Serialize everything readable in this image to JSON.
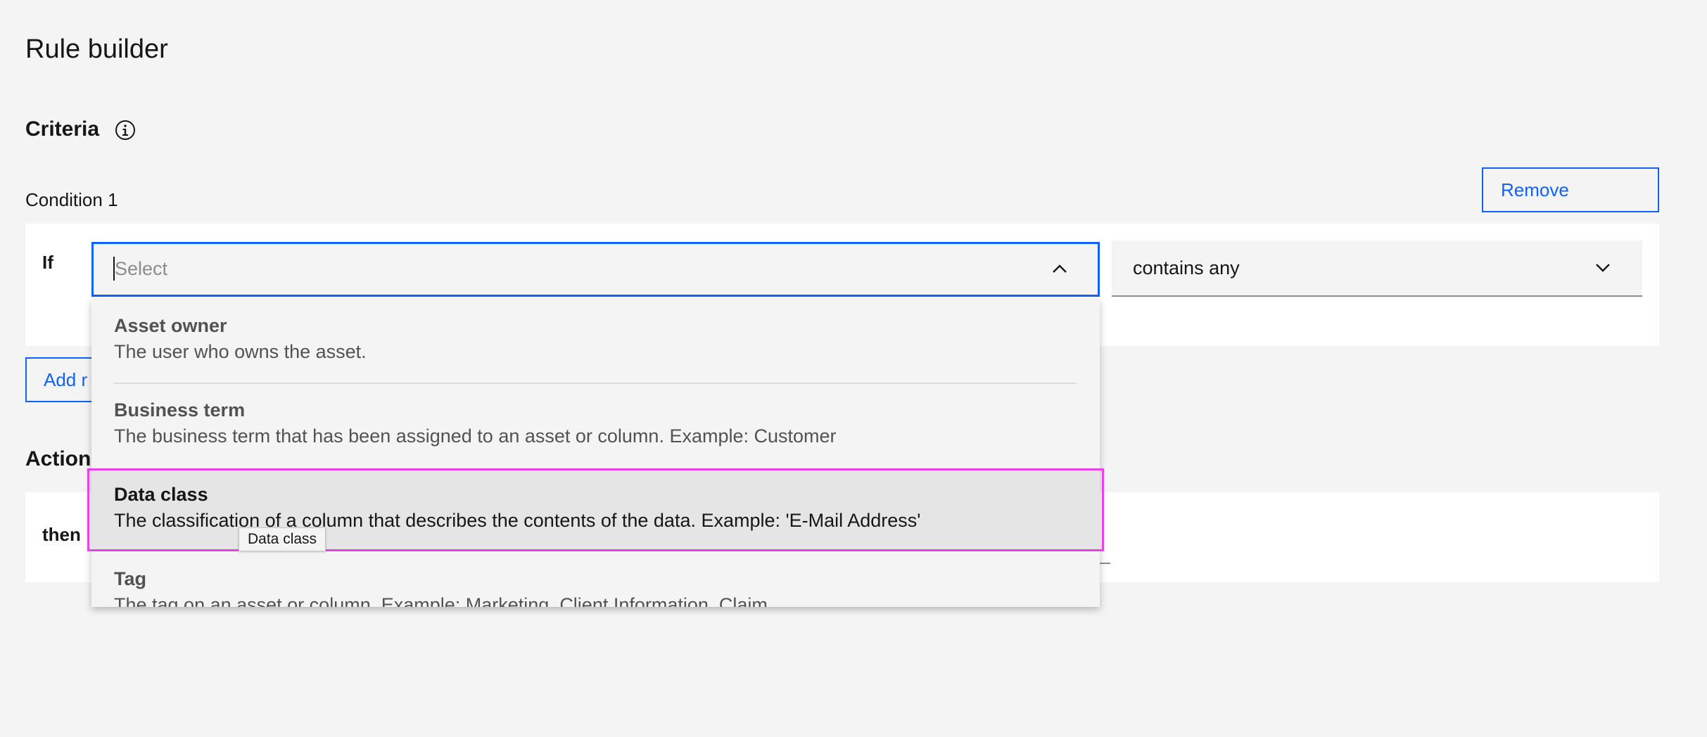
{
  "header": {
    "title": "Rule builder"
  },
  "criteria": {
    "heading": "Criteria"
  },
  "condition": {
    "label": "Condition 1",
    "remove_label": "Remove",
    "if_label": "If",
    "select_placeholder": "Select",
    "operator_value": "contains any"
  },
  "add_button_label": "Add r",
  "actions": {
    "heading": "Action",
    "then_label": "then"
  },
  "dropdown": {
    "options": [
      {
        "title": "Asset owner",
        "description": "The user who owns the asset."
      },
      {
        "title": "Business term",
        "description": "The business term that has been assigned to an asset or column. Example: Customer"
      },
      {
        "title": "Data class",
        "description": "The classification of a column that describes the contents of the data. Example: 'E-Mail Address'"
      },
      {
        "title": "Tag",
        "description": "The tag on an asset or column. Example: Marketing, Client Information, Claim"
      }
    ],
    "selected_index": 2
  },
  "tooltip": {
    "text": "Data class"
  },
  "colors": {
    "accent": "#0f62fe",
    "highlight": "#e843e8",
    "background": "#f4f4f4"
  },
  "icons": {
    "info": "info-icon",
    "select_open": "chevron-up-icon",
    "operator": "chevron-down-icon"
  }
}
